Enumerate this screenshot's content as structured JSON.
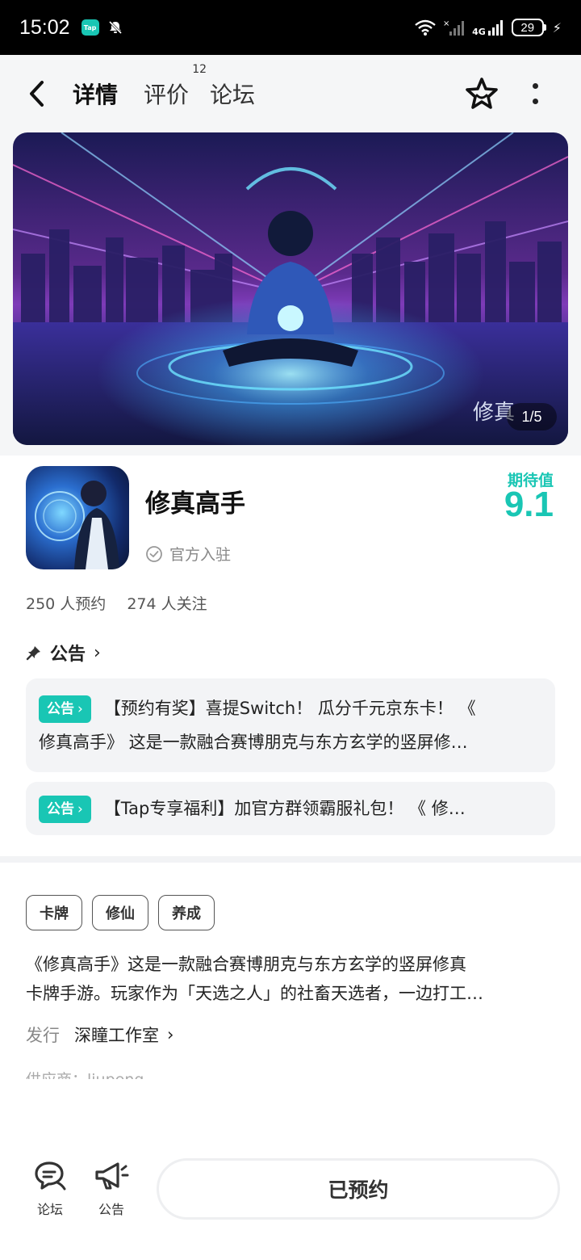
{
  "status_bar": {
    "time": "15:02",
    "tap_badge": "Tap",
    "network": "4G",
    "battery": "29"
  },
  "header": {
    "tabs": [
      {
        "label": "详情",
        "active": true
      },
      {
        "label": "评价",
        "count": "12"
      },
      {
        "label": "论坛"
      }
    ],
    "icons": [
      "back-icon",
      "star-icon",
      "more-icon"
    ]
  },
  "banner": {
    "counter": "1/5"
  },
  "app": {
    "name": "修真高手",
    "official": "官方入驻",
    "expect_label": "期待值",
    "expect_value": "9.1",
    "reservations": "250 人预约",
    "followers": "274 人关注"
  },
  "notices": {
    "title": "公告",
    "items": [
      {
        "tag": "公告",
        "line1": "【预约有奖】喜提Switch！ 瓜分千元京东卡！ 《",
        "line2": "修真高手》 这是一款融合赛博朋克与东方玄学的竖屏修…"
      },
      {
        "tag": "公告",
        "line1": "【Tap专享福利】加官方群领霸服礼包！ 《 修…"
      }
    ]
  },
  "tags": [
    "卡牌",
    "修仙",
    "养成"
  ],
  "description": {
    "line1": "《修真高手》这是一款融合赛博朋克与东方玄学的竖屏修真",
    "line2": "卡牌手游。玩家作为「天选之人」的社畜天选者，一边打工…"
  },
  "publisher": {
    "label": "发行",
    "value": "深瞳工作室"
  },
  "supplier_partial": "供应商：liupeng",
  "bottom_bar": {
    "forum_label": "论坛",
    "notice_label": "公告",
    "reserve_button": "已预约"
  },
  "colors": {
    "accent": "#19c6b4",
    "background": "#f5f6f7"
  }
}
